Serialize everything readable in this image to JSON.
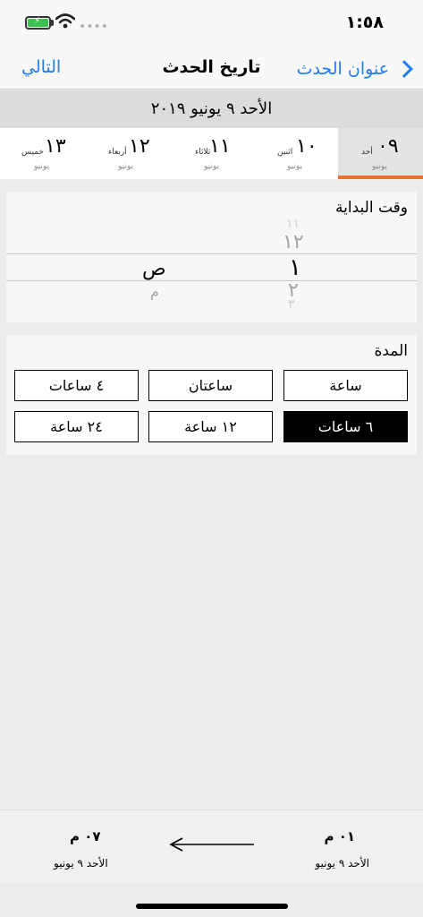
{
  "status": {
    "time": "١:٥٨",
    "battery_color": "#3cc04f"
  },
  "nav": {
    "back_label": "عنوان الحدث",
    "title": "تاريخ الحدث",
    "next_label": "التالي",
    "accent": "#1f7cf2"
  },
  "date_header": "الأحد ٩ يونيو ٢٠١٩",
  "days": [
    {
      "num": "٠٩",
      "name": "أحد",
      "month": "يونيو",
      "selected": true
    },
    {
      "num": "١٠",
      "name": "اثنين",
      "month": "يونيو",
      "selected": false
    },
    {
      "num": "١١",
      "name": "ثلاثاء",
      "month": "يونيو",
      "selected": false
    },
    {
      "num": "١٢",
      "name": "أربعاء",
      "month": "يونيو",
      "selected": false
    },
    {
      "num": "١٣",
      "name": "خميس",
      "month": "يونيو",
      "selected": false
    }
  ],
  "start_time": {
    "label": "وقت البداية",
    "hour_items": [
      "١١",
      "١٢",
      "١",
      "٢",
      "٣"
    ],
    "selected_hour": "١",
    "period_items": [
      "ص",
      "م"
    ],
    "selected_period": "ص"
  },
  "duration": {
    "label": "المدة",
    "options": [
      "ساعة",
      "ساعتان",
      "٤ ساعات",
      "٦ ساعات",
      "١٢ ساعة",
      "٢٤ ساعة"
    ],
    "selected": "٦ ساعات"
  },
  "footer": {
    "start_time": "٠١ م",
    "start_date": "الأحد ٩ يونيو",
    "end_time": "٠٧ م",
    "end_date": "الأحد ٩ يونيو"
  },
  "colors": {
    "selected_underline": "#f0702a"
  }
}
